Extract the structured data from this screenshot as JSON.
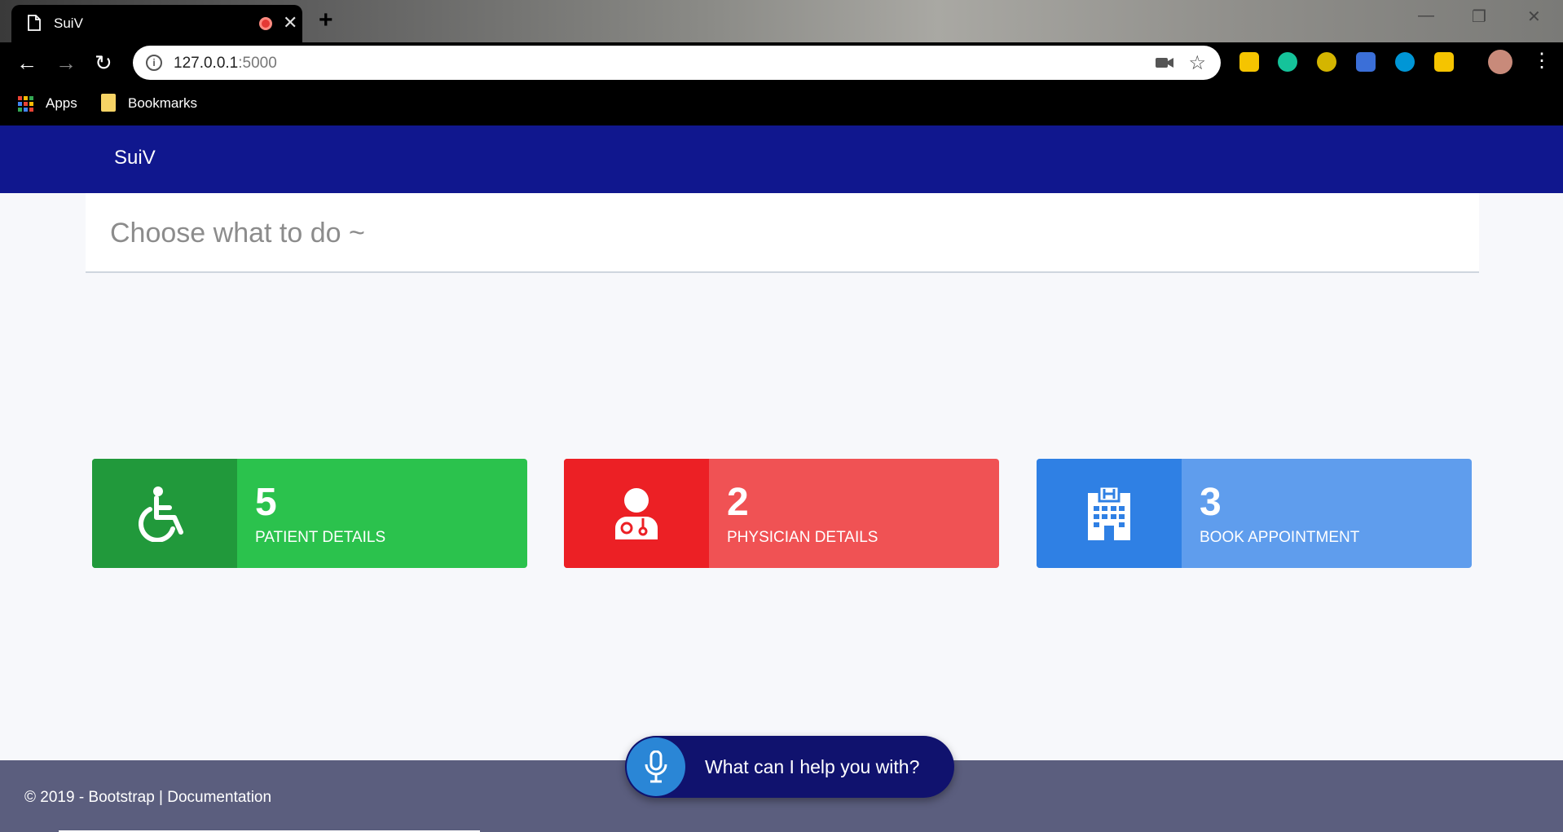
{
  "browser": {
    "tab_title": "SuiV",
    "new_tab": "+",
    "url_host": "127.0.0.1",
    "url_port": ":5000",
    "bookmarks": {
      "apps_label": "Apps",
      "bookmarks_label": "Bookmarks"
    }
  },
  "app": {
    "brand": "SuiV",
    "heading": "Choose what to do ~"
  },
  "cards": [
    {
      "count": "5",
      "label": "PATIENT DETAILS",
      "icon": "wheelchair-icon",
      "color": "#2bc24d"
    },
    {
      "count": "2",
      "label": "PHYSICIAN DETAILS",
      "icon": "doctor-icon",
      "color": "#f05254"
    },
    {
      "count": "3",
      "label": "BOOK APPOINTMENT",
      "icon": "hospital-icon",
      "color": "#5f9ded"
    }
  ],
  "voice": {
    "prompt": "What can I help you with?",
    "icon": "microphone-icon"
  },
  "footer": {
    "text": "© 2019 - Bootstrap | Documentation"
  }
}
